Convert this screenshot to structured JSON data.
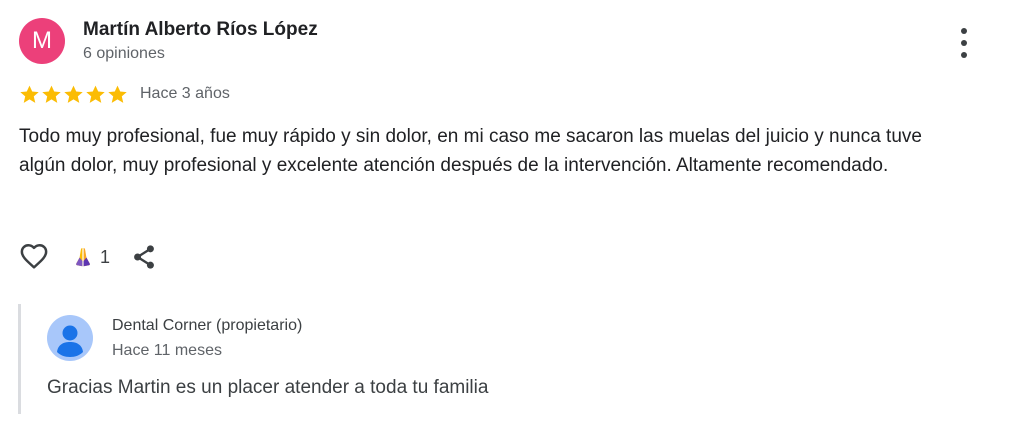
{
  "review": {
    "author": {
      "initial": "M",
      "name": "Martín Alberto Ríos López",
      "meta": "6 opiniones",
      "avatar_color": "#ec407a"
    },
    "menu_icon": "more-vert-icon",
    "rating": 5,
    "rating_max": 5,
    "star_color": "#fbbc04",
    "date": "Hace 3 años",
    "text": "Todo muy profesional, fue muy rápido y sin dolor, en mi caso me sacaron las muelas del juicio y nunca tuve algún dolor, muy profesional y excelente atención después de la intervención. Altamente recomendado.",
    "actions": {
      "like_icon": "heart-outline-icon",
      "reaction_icon": "praying-hands-icon",
      "reaction_count": "1",
      "share_icon": "share-icon"
    }
  },
  "reply": {
    "avatar_icon": "default-user-avatar-icon",
    "owner": "Dental Corner (propietario)",
    "date": "Hace 11 meses",
    "text": "Gracias Martin es un placer atender a toda tu familia"
  }
}
